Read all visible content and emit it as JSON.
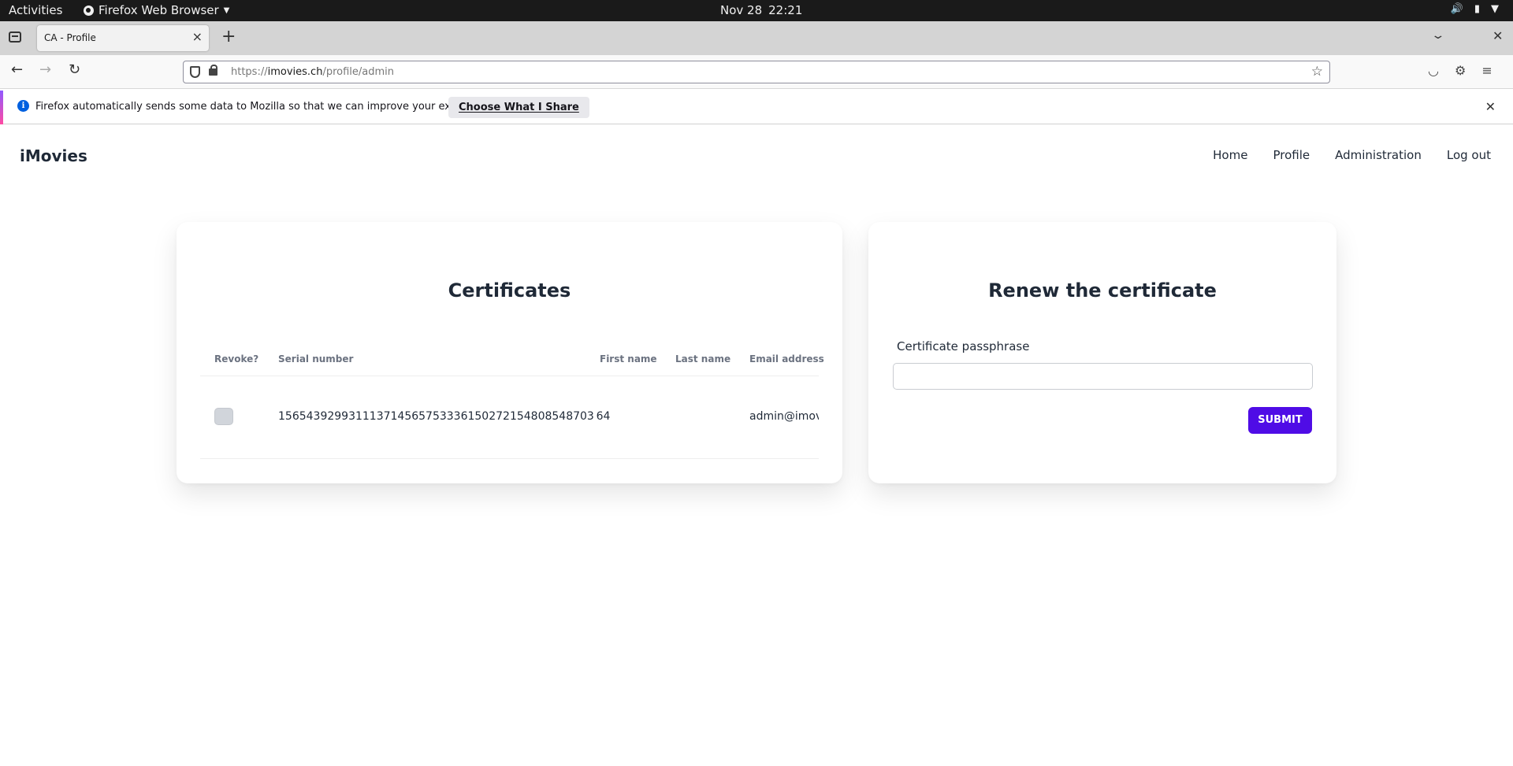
{
  "system_bar": {
    "activities": "Activities",
    "app_name": "Firefox Web Browser",
    "date": "Nov 28",
    "time": "22:21"
  },
  "browser": {
    "tab_title": "CA - Profile",
    "url_prefix": "https://",
    "url_host": "imovies.ch",
    "url_path": "/profile/admin"
  },
  "notification": {
    "message": "Firefox automatically sends some data to Mozilla so that we can improve your experience.",
    "button_label": "Choose What I Share"
  },
  "site": {
    "brand": "iMovies",
    "nav": [
      "Home",
      "Profile",
      "Administration",
      "Log out"
    ]
  },
  "certificates": {
    "title": "Certificates",
    "columns": [
      "Revoke?",
      "Serial number",
      "First name",
      "Last name",
      "Email address"
    ],
    "rows": [
      {
        "revoke": false,
        "serial": "156543929931113714565753336150272154808548703 64",
        "first_name": "",
        "last_name": "",
        "email": "admin@imov"
      }
    ]
  },
  "renew": {
    "title": "Renew the certificate",
    "field_label": "Certificate passphrase",
    "field_value": "",
    "submit_label": "SUBMIT"
  }
}
